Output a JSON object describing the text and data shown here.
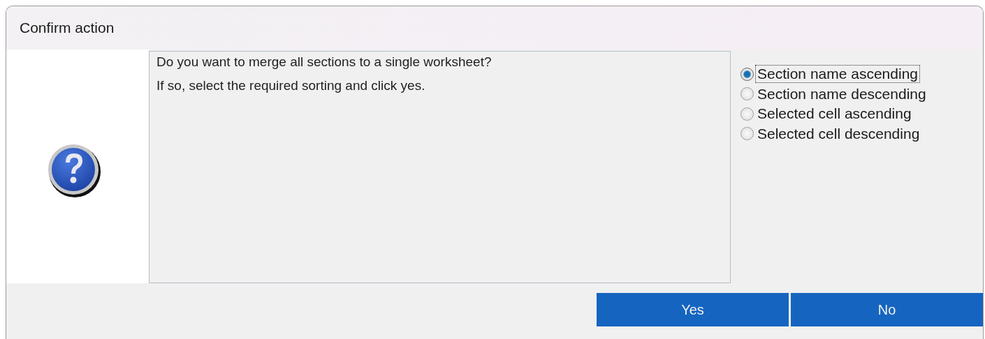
{
  "window": {
    "title": "Confirm action"
  },
  "message": [
    "Do you want to merge all sections to a single worksheet?",
    "If so, select the required sorting and click yes."
  ],
  "sort_options": [
    {
      "label": "Section name ascending",
      "selected": true,
      "focused": true
    },
    {
      "label": "Section name descending",
      "selected": false,
      "focused": false
    },
    {
      "label": "Selected cell ascending",
      "selected": false,
      "focused": false
    },
    {
      "label": "Selected cell descending",
      "selected": false,
      "focused": false
    }
  ],
  "buttons": [
    "Yes",
    "No"
  ]
}
